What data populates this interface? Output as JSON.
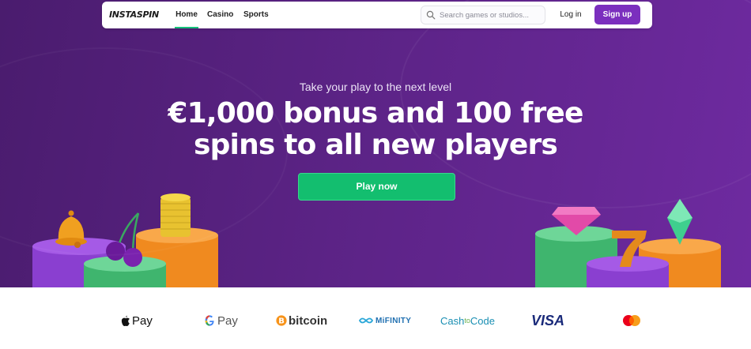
{
  "brand": {
    "logo_text": "INSTASPIN"
  },
  "nav": {
    "links": [
      {
        "label": "Home",
        "active": true
      },
      {
        "label": "Casino",
        "active": false
      },
      {
        "label": "Sports",
        "active": false
      }
    ],
    "search_placeholder": "Search games or studios...",
    "login_label": "Log in",
    "signup_label": "Sign up"
  },
  "hero": {
    "kicker": "Take your play to the next level",
    "headline_line1": "€1,000 bonus and 100 free",
    "headline_line2": "spins to all new players",
    "cta_label": "Play now"
  },
  "payments": {
    "apple_pay": "Pay",
    "google_pay": "Pay",
    "bitcoin": "bitcoin",
    "mifinity": "MiFINITY",
    "cashtocode_a": "Cash",
    "cashtocode_b": "to",
    "cashtocode_c": "Code",
    "visa": "VISA"
  },
  "colors": {
    "accent_purple": "#7b2fbe",
    "cta_green": "#13be6f",
    "hero_bg": "#5b2385",
    "active_underline": "#16c07a"
  },
  "icons": [
    "search-icon",
    "apple-icon",
    "google-g-icon",
    "bitcoin-icon",
    "mifinity-icon",
    "mastercard-icon",
    "bell-icon",
    "cherries-icon",
    "coin-stack-icon",
    "gem-icon",
    "seven-icon",
    "emerald-icon"
  ]
}
